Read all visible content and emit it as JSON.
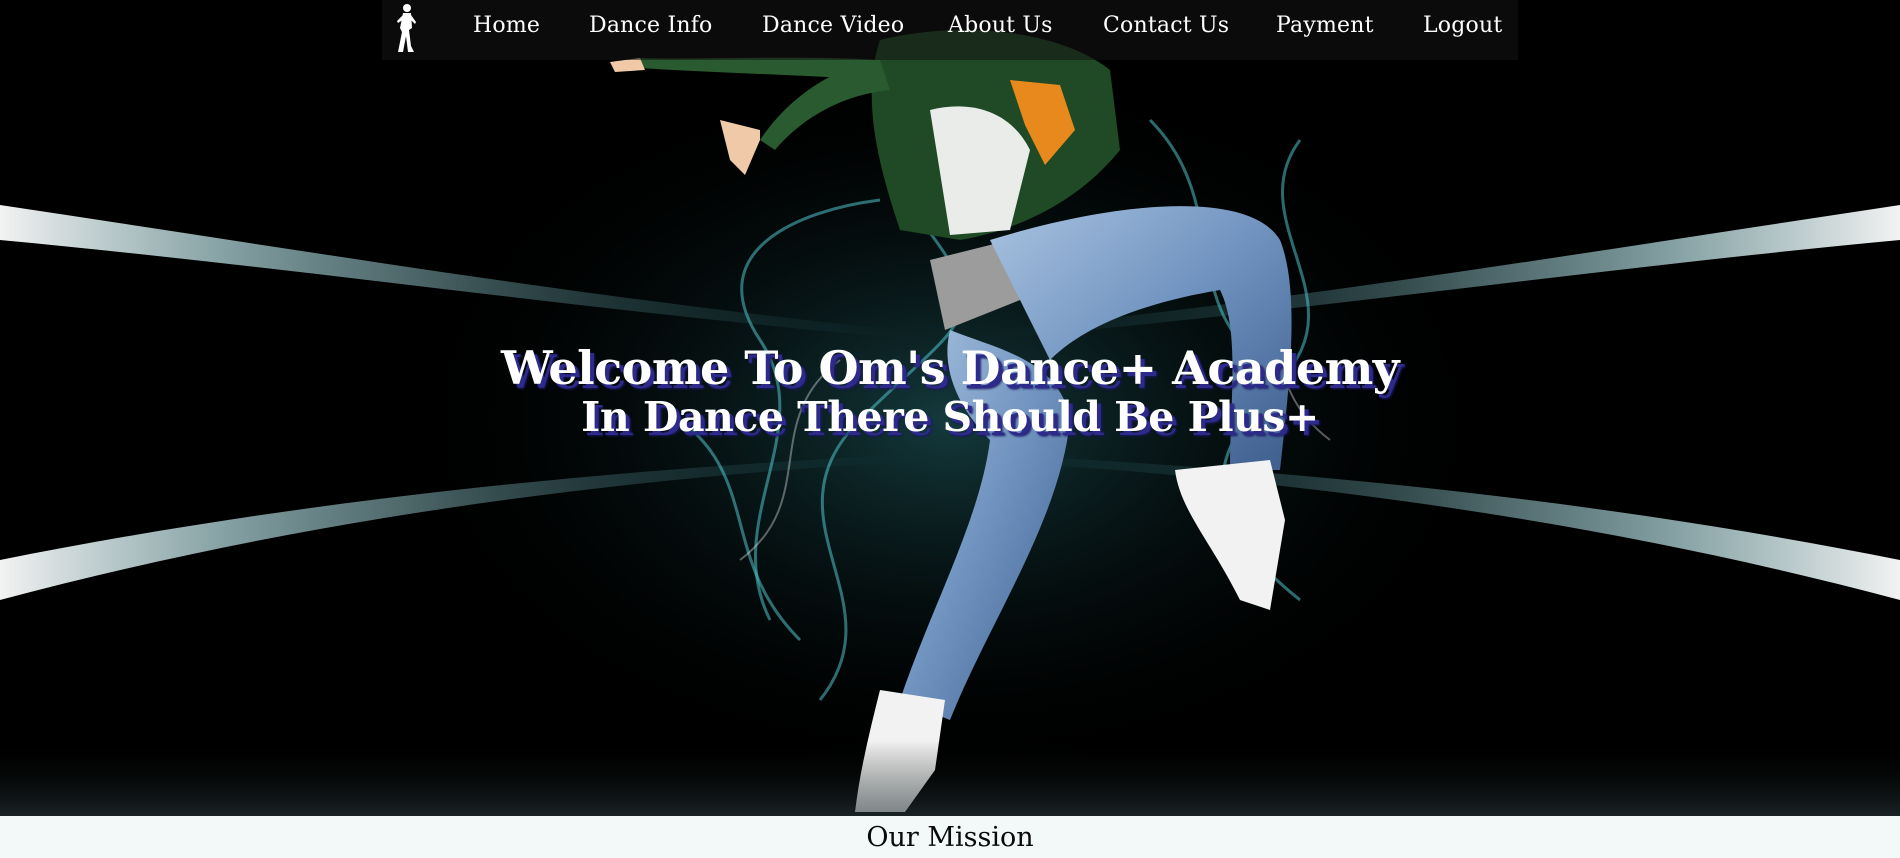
{
  "nav": {
    "items": [
      {
        "label": "Home"
      },
      {
        "label": "Dance Info"
      },
      {
        "label": "Dance Video"
      },
      {
        "label": "About Us"
      },
      {
        "label": "Contact Us"
      },
      {
        "label": "Payment"
      },
      {
        "label": "Logout"
      }
    ]
  },
  "hero": {
    "title": "Welcome To Om's Dance+ Academy",
    "subtitle": "In Dance There Should Be Plus+"
  },
  "mission": {
    "title": "Our Mission"
  },
  "colors": {
    "background": "#000000",
    "nav_text": "#ffffff",
    "headline_shadow": "#2d2a8c",
    "smoke_cyan": "#4fc3c9",
    "mission_bg": "#f3f8f8"
  },
  "icons": {
    "logo": "dancer-silhouette-icon"
  }
}
